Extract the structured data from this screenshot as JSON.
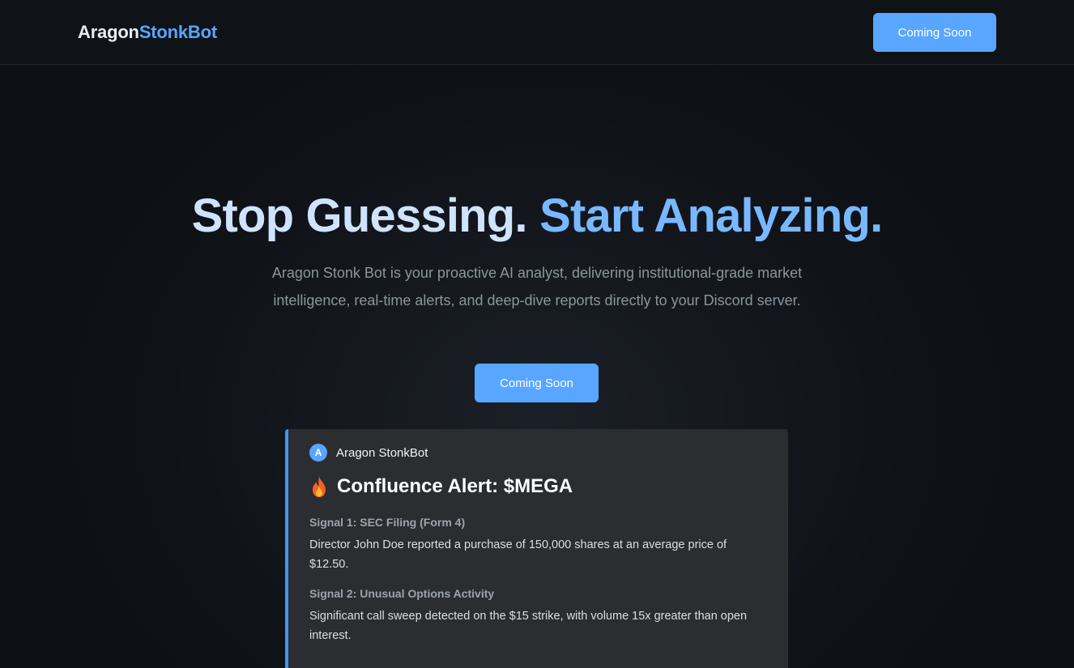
{
  "header": {
    "brand_part1": "Aragon",
    "brand_part2": "StonkBot",
    "cta_label": "Coming Soon"
  },
  "hero": {
    "title_part1": "Stop Guessing.",
    "title_part2": "Start Analyzing.",
    "subtitle": "Aragon Stonk Bot is your proactive AI analyst, delivering institutional-grade market intelligence, real-time alerts, and deep-dive reports directly to your Discord server.",
    "cta_label": "Coming Soon"
  },
  "preview_card": {
    "avatar_letter": "A",
    "author": "Aragon StonkBot",
    "alert_icon": "fire-icon",
    "alert_title": "Confluence Alert: $MEGA",
    "signals": [
      {
        "label": "Signal 1: SEC Filing (Form 4)",
        "text": "Director John Doe reported a purchase of 150,000 shares at an average price of $12.50."
      },
      {
        "label": "Signal 2: Unusual Options Activity",
        "text": "Significant call sweep detected on the $15 strike, with volume 15x greater than open interest."
      }
    ]
  },
  "colors": {
    "accent": "#58a6ff",
    "background": "#0e1116",
    "card": "#2b2d31"
  }
}
